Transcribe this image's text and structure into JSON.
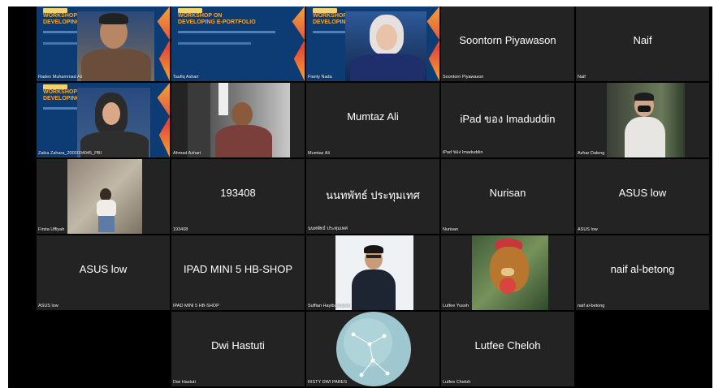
{
  "slide": {
    "line1": "WORKSHOP ON",
    "line2": "DEVELOPING E-PORTFOLIO",
    "line2_cut": "DEVELOPING E-P"
  },
  "participants": [
    {
      "name": "Raden Muhammad Ali"
    },
    {
      "name": "Taufiq Ashari"
    },
    {
      "name": "Fianty Nada"
    },
    {
      "name": "Soontorn Piyawason"
    },
    {
      "name": "Naif"
    },
    {
      "name": "Zakia Zahara_2000004045_PBI"
    },
    {
      "name": "Ahmad Azhari"
    },
    {
      "name": "Mumtaz Ali"
    },
    {
      "name": "iPad ของ Imaduddin"
    },
    {
      "name": "Azhar Daleng"
    },
    {
      "name": "Firsta Uffiyah"
    },
    {
      "name": "193408"
    },
    {
      "name": "นนทพัทธ์ ประทุมเทศ"
    },
    {
      "name": "Nurisan"
    },
    {
      "name": "ASUS low"
    },
    {
      "name": "ASUS low"
    },
    {
      "name": "IPAD MINI 5 HB-SHOP"
    },
    {
      "name": "Suffian Hayibuerahen"
    },
    {
      "name": "Lutfee Yusoh"
    },
    {
      "name": "naif al-betong"
    },
    {
      "name": "Dwi Hastuti"
    },
    {
      "name": "RISTY DWI PARES"
    },
    {
      "name": "Lutfee Cheloh"
    }
  ],
  "colors": {
    "tile": "#232323",
    "slide_bg": "#0d3b73",
    "slide_title": "#f3a93a"
  }
}
